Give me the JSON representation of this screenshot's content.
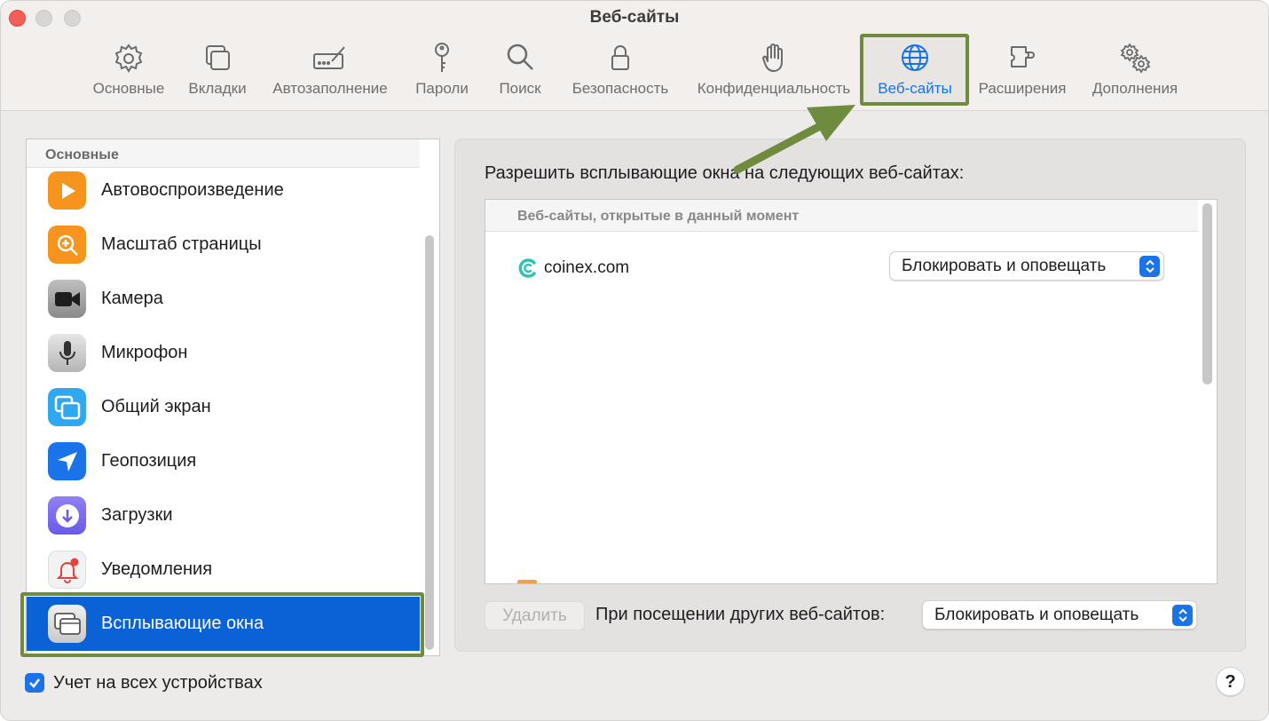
{
  "window": {
    "title": "Веб-сайты"
  },
  "toolbar": {
    "items": [
      {
        "label": "Основные",
        "icon": "gear-icon"
      },
      {
        "label": "Вкладки",
        "icon": "tabs-icon"
      },
      {
        "label": "Автозаполнение",
        "icon": "autofill-icon"
      },
      {
        "label": "Пароли",
        "icon": "key-icon"
      },
      {
        "label": "Поиск",
        "icon": "search-icon"
      },
      {
        "label": "Безопасность",
        "icon": "lock-icon"
      },
      {
        "label": "Конфиденциальность",
        "icon": "hand-icon"
      },
      {
        "label": "Веб-сайты",
        "icon": "globe-icon",
        "active": true
      },
      {
        "label": "Расширения",
        "icon": "puzzle-icon"
      },
      {
        "label": "Дополнения",
        "icon": "gears-icon"
      }
    ],
    "active_color": "#1473e6"
  },
  "sidebar": {
    "header": "Основные",
    "items": [
      {
        "label": "Автовоспроизведение",
        "icon": "play-icon",
        "color": "#f7941d"
      },
      {
        "label": "Масштаб страницы",
        "icon": "zoom-icon",
        "color": "#f7941d"
      },
      {
        "label": "Камера",
        "icon": "camera-icon",
        "color": "#8a8a8a"
      },
      {
        "label": "Микрофон",
        "icon": "microphone-icon",
        "color": "#bdbdbd"
      },
      {
        "label": "Общий экран",
        "icon": "screen-share-icon",
        "color": "#2fa8f0"
      },
      {
        "label": "Геопозиция",
        "icon": "location-icon",
        "color": "#1a73e8"
      },
      {
        "label": "Загрузки",
        "icon": "downloads-icon",
        "color": "#7b6cf0"
      },
      {
        "label": "Уведомления",
        "icon": "bell-icon",
        "color": "#f2f2f2"
      },
      {
        "label": "Всплывающие окна",
        "icon": "popup-windows-icon",
        "color": "#d8d8d8",
        "selected": true
      }
    ],
    "selected_color": "#0a62d6"
  },
  "main": {
    "title": "Разрешить всплывающие окна на следующих веб-сайтах:",
    "table": {
      "header": "Веб-сайты, открытые в данный момент",
      "rows": [
        {
          "site": "coinex.com",
          "setting": "Блокировать и оповещать"
        }
      ]
    },
    "delete_button": "Удалить",
    "other_sites_label": "При посещении других веб-сайтов:",
    "other_sites_value": "Блокировать и оповещать"
  },
  "footer": {
    "sync_label": "Учет на всех устройствах",
    "sync_checked": true,
    "help": "?"
  },
  "annotation_color": "#6f8b3d"
}
